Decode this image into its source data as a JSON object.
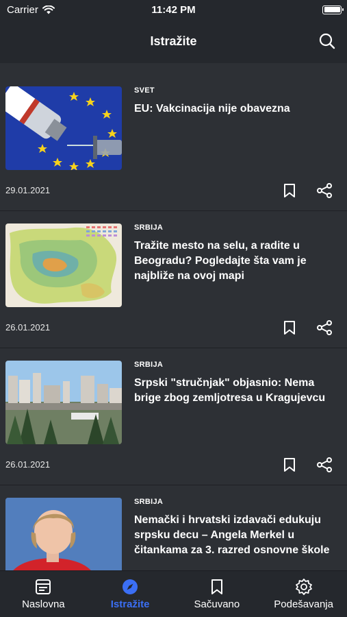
{
  "status_bar": {
    "carrier": "Carrier",
    "time": "11:42 PM",
    "battery_level": 1.0
  },
  "header": {
    "title": "Istražite"
  },
  "articles": [
    {
      "category": "SVET",
      "title": "EU: Vakcinacija nije obavezna",
      "date": "29.01.2021"
    },
    {
      "category": "SRBIJA",
      "title": "Tražite mesto na selu, a radite u Beogradu? Pogledajte šta vam je najbliže na ovoj mapi",
      "date": "26.01.2021"
    },
    {
      "category": "SRBIJA",
      "title": "Srpski \"stručnjak\" objasnio: Nema brige zbog zemljotresa u Kragujevcu",
      "date": "26.01.2021"
    },
    {
      "category": "SRBIJA",
      "title": "Nemački i hrvatski izdavači edukuju srpsku decu – Angela Merkel u čitankama za 3. razred osnovne škole",
      "date": ""
    }
  ],
  "tabs": [
    {
      "label": "Naslovna",
      "icon": "home-icon",
      "active": false
    },
    {
      "label": "Istražite",
      "icon": "compass-icon",
      "active": true
    },
    {
      "label": "Sačuvano",
      "icon": "bookmark-icon",
      "active": false
    },
    {
      "label": "Podešavanja",
      "icon": "gear-icon",
      "active": false
    }
  ],
  "colors": {
    "background": "#2d3035",
    "bar": "#25282d",
    "accent": "#3b6ff5"
  }
}
